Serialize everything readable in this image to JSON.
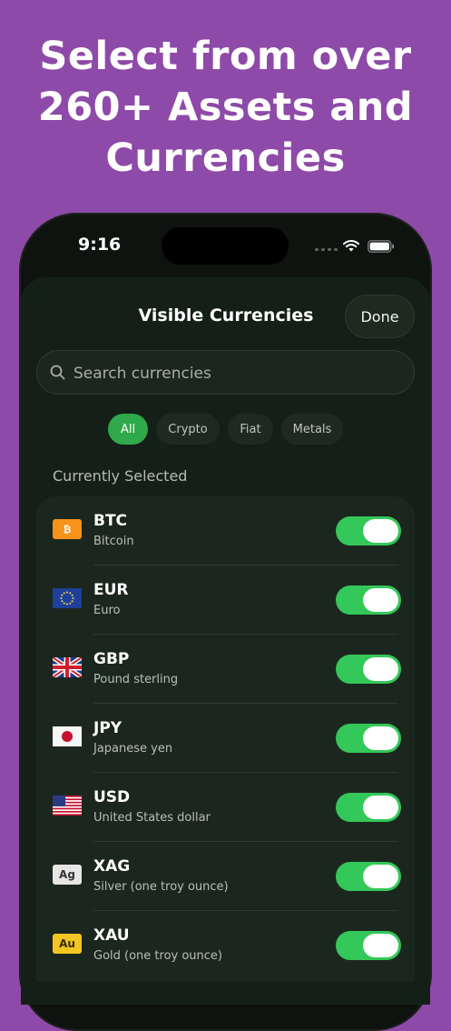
{
  "promo": {
    "line1": "Select from over",
    "line2": "260+ Assets and",
    "line3": "Currencies"
  },
  "status_bar": {
    "time": "9:16"
  },
  "sheet": {
    "title": "Visible Currencies",
    "done_label": "Done",
    "search_placeholder": "Search currencies",
    "filters": [
      "All",
      "Crypto",
      "Fiat",
      "Metals"
    ],
    "active_filter": "All",
    "section_label": "Currently Selected"
  },
  "currencies": [
    {
      "code": "BTC",
      "name": "Bitcoin",
      "icon": "bitcoin-icon",
      "enabled": true
    },
    {
      "code": "EUR",
      "name": "Euro",
      "icon": "eu-flag-icon",
      "enabled": true
    },
    {
      "code": "GBP",
      "name": "Pound sterling",
      "icon": "uk-flag-icon",
      "enabled": true
    },
    {
      "code": "JPY",
      "name": "Japanese yen",
      "icon": "japan-flag-icon",
      "enabled": true
    },
    {
      "code": "USD",
      "name": "United States dollar",
      "icon": "us-flag-icon",
      "enabled": true
    },
    {
      "code": "XAG",
      "name": "Silver (one troy ounce)",
      "icon": "silver-icon",
      "enabled": true
    },
    {
      "code": "XAU",
      "name": "Gold (one troy ounce)",
      "icon": "gold-icon",
      "enabled": true
    }
  ],
  "badges": {
    "btc": "₿",
    "ag": "Ag",
    "au": "Au"
  },
  "colors": {
    "background": "#8e4aa8",
    "accent": "#34c759",
    "active_chip": "#2fa94b"
  }
}
